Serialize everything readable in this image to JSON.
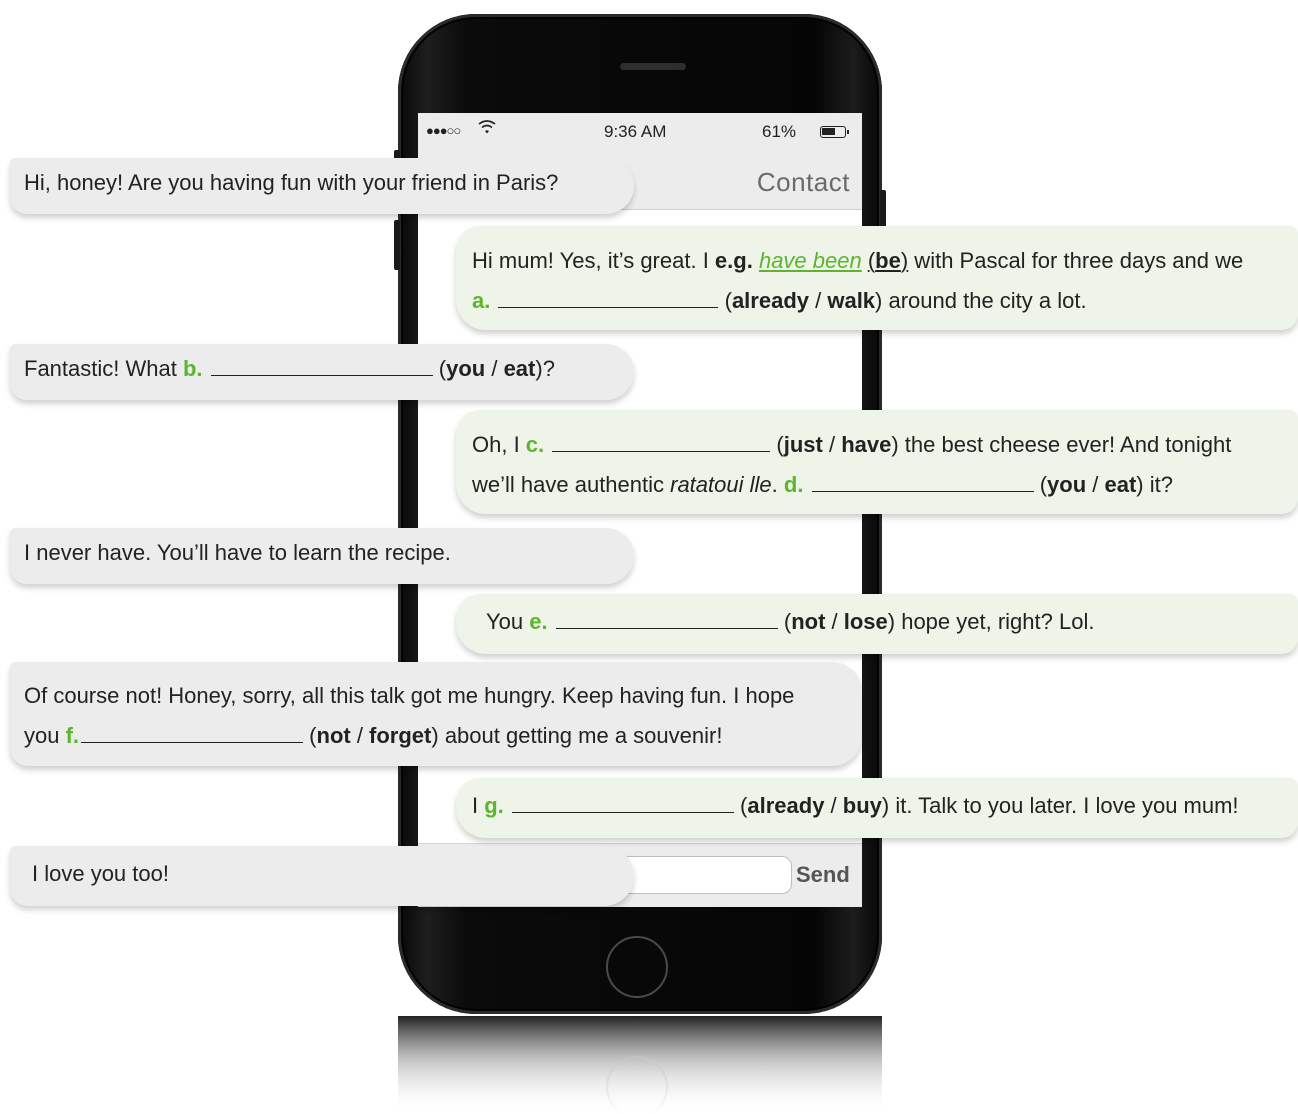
{
  "status_bar": {
    "signal": "●●●○○",
    "time": "9:36 AM",
    "battery": "61%",
    "battery_level": 0.61
  },
  "nav": {
    "title": "Contact"
  },
  "input_bar": {
    "send_label": "Send"
  },
  "messages": [
    {
      "side": "left",
      "text": "Hi, honey! Are you having fun with your friend in Paris?"
    },
    {
      "side": "right",
      "t1": "Hi mum! Yes, it’s great. I ",
      "eg": "e.g.",
      "answer": "have been",
      "verb": "be",
      "t2": " with Pascal for three days and we",
      "letter": "a.",
      "hint1": "already",
      "hint2": "walk",
      "t3": " around the city a lot."
    },
    {
      "side": "left",
      "t1": "Fantastic! What ",
      "letter": "b.",
      "hint1": "you",
      "hint2": "eat",
      "t2": "?"
    },
    {
      "side": "right",
      "t1": "Oh, I ",
      "letter1": "c.",
      "hint1a": "just",
      "hint1b": "have",
      "t2": " the best cheese ever! And tonight",
      "t3": "we’ll have authentic ",
      "dish": "ratatoui lle",
      "t4": ". ",
      "letter2": "d.",
      "hint2a": "you",
      "hint2b": "eat",
      "t5": " it?"
    },
    {
      "side": "left",
      "text": "I never have. You’ll have to learn the recipe."
    },
    {
      "side": "right",
      "t1": "You ",
      "letter": "e.",
      "hint1": "not",
      "hint2": "lose",
      "t2": " hope yet, right? Lol."
    },
    {
      "side": "left",
      "t1": "Of course not! Honey, sorry, all this talk got me hungry. Keep having fun. I hope",
      "t2": "you ",
      "letter": "f.",
      "hint1": "not",
      "hint2": "forget",
      "t3": " about getting me a souvenir!"
    },
    {
      "side": "right",
      "t1": "I ",
      "letter": "g.",
      "hint1": "already",
      "hint2": "buy",
      "t2": " it. Talk to you later. I love you mum!"
    },
    {
      "side": "left",
      "text": "I love you too!"
    }
  ],
  "punct": {
    "open": "(",
    "close": ")",
    "slash": " / "
  },
  "colors": {
    "accent_green": "#5cb52c",
    "bubble_left": "#ececec",
    "bubble_right": "#eef4e8",
    "phone_body": "#0b0b0b"
  }
}
